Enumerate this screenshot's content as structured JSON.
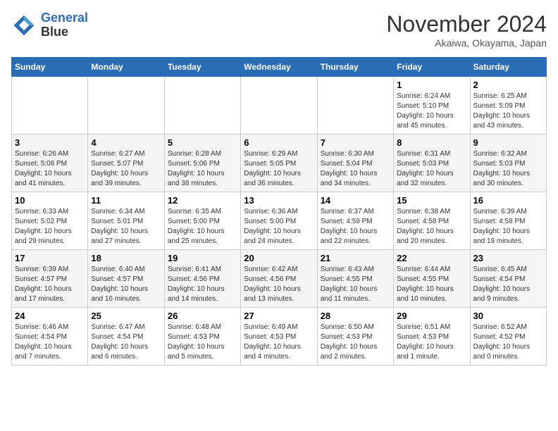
{
  "logo": {
    "line1": "General",
    "line2": "Blue"
  },
  "title": "November 2024",
  "subtitle": "Akaiwa, Okayama, Japan",
  "weekdays": [
    "Sunday",
    "Monday",
    "Tuesday",
    "Wednesday",
    "Thursday",
    "Friday",
    "Saturday"
  ],
  "weeks": [
    [
      {
        "day": "",
        "info": ""
      },
      {
        "day": "",
        "info": ""
      },
      {
        "day": "",
        "info": ""
      },
      {
        "day": "",
        "info": ""
      },
      {
        "day": "",
        "info": ""
      },
      {
        "day": "1",
        "info": "Sunrise: 6:24 AM\nSunset: 5:10 PM\nDaylight: 10 hours\nand 45 minutes."
      },
      {
        "day": "2",
        "info": "Sunrise: 6:25 AM\nSunset: 5:09 PM\nDaylight: 10 hours\nand 43 minutes."
      }
    ],
    [
      {
        "day": "3",
        "info": "Sunrise: 6:26 AM\nSunset: 5:08 PM\nDaylight: 10 hours\nand 41 minutes."
      },
      {
        "day": "4",
        "info": "Sunrise: 6:27 AM\nSunset: 5:07 PM\nDaylight: 10 hours\nand 39 minutes."
      },
      {
        "day": "5",
        "info": "Sunrise: 6:28 AM\nSunset: 5:06 PM\nDaylight: 10 hours\nand 38 minutes."
      },
      {
        "day": "6",
        "info": "Sunrise: 6:29 AM\nSunset: 5:05 PM\nDaylight: 10 hours\nand 36 minutes."
      },
      {
        "day": "7",
        "info": "Sunrise: 6:30 AM\nSunset: 5:04 PM\nDaylight: 10 hours\nand 34 minutes."
      },
      {
        "day": "8",
        "info": "Sunrise: 6:31 AM\nSunset: 5:03 PM\nDaylight: 10 hours\nand 32 minutes."
      },
      {
        "day": "9",
        "info": "Sunrise: 6:32 AM\nSunset: 5:03 PM\nDaylight: 10 hours\nand 30 minutes."
      }
    ],
    [
      {
        "day": "10",
        "info": "Sunrise: 6:33 AM\nSunset: 5:02 PM\nDaylight: 10 hours\nand 29 minutes."
      },
      {
        "day": "11",
        "info": "Sunrise: 6:34 AM\nSunset: 5:01 PM\nDaylight: 10 hours\nand 27 minutes."
      },
      {
        "day": "12",
        "info": "Sunrise: 6:35 AM\nSunset: 5:00 PM\nDaylight: 10 hours\nand 25 minutes."
      },
      {
        "day": "13",
        "info": "Sunrise: 6:36 AM\nSunset: 5:00 PM\nDaylight: 10 hours\nand 24 minutes."
      },
      {
        "day": "14",
        "info": "Sunrise: 6:37 AM\nSunset: 4:59 PM\nDaylight: 10 hours\nand 22 minutes."
      },
      {
        "day": "15",
        "info": "Sunrise: 6:38 AM\nSunset: 4:58 PM\nDaylight: 10 hours\nand 20 minutes."
      },
      {
        "day": "16",
        "info": "Sunrise: 6:39 AM\nSunset: 4:58 PM\nDaylight: 10 hours\nand 19 minutes."
      }
    ],
    [
      {
        "day": "17",
        "info": "Sunrise: 6:39 AM\nSunset: 4:57 PM\nDaylight: 10 hours\nand 17 minutes."
      },
      {
        "day": "18",
        "info": "Sunrise: 6:40 AM\nSunset: 4:57 PM\nDaylight: 10 hours\nand 16 minutes."
      },
      {
        "day": "19",
        "info": "Sunrise: 6:41 AM\nSunset: 4:56 PM\nDaylight: 10 hours\nand 14 minutes."
      },
      {
        "day": "20",
        "info": "Sunrise: 6:42 AM\nSunset: 4:56 PM\nDaylight: 10 hours\nand 13 minutes."
      },
      {
        "day": "21",
        "info": "Sunrise: 6:43 AM\nSunset: 4:55 PM\nDaylight: 10 hours\nand 11 minutes."
      },
      {
        "day": "22",
        "info": "Sunrise: 6:44 AM\nSunset: 4:55 PM\nDaylight: 10 hours\nand 10 minutes."
      },
      {
        "day": "23",
        "info": "Sunrise: 6:45 AM\nSunset: 4:54 PM\nDaylight: 10 hours\nand 9 minutes."
      }
    ],
    [
      {
        "day": "24",
        "info": "Sunrise: 6:46 AM\nSunset: 4:54 PM\nDaylight: 10 hours\nand 7 minutes."
      },
      {
        "day": "25",
        "info": "Sunrise: 6:47 AM\nSunset: 4:54 PM\nDaylight: 10 hours\nand 6 minutes."
      },
      {
        "day": "26",
        "info": "Sunrise: 6:48 AM\nSunset: 4:53 PM\nDaylight: 10 hours\nand 5 minutes."
      },
      {
        "day": "27",
        "info": "Sunrise: 6:49 AM\nSunset: 4:53 PM\nDaylight: 10 hours\nand 4 minutes."
      },
      {
        "day": "28",
        "info": "Sunrise: 6:50 AM\nSunset: 4:53 PM\nDaylight: 10 hours\nand 2 minutes."
      },
      {
        "day": "29",
        "info": "Sunrise: 6:51 AM\nSunset: 4:53 PM\nDaylight: 10 hours\nand 1 minute."
      },
      {
        "day": "30",
        "info": "Sunrise: 6:52 AM\nSunset: 4:52 PM\nDaylight: 10 hours\nand 0 minutes."
      }
    ]
  ]
}
